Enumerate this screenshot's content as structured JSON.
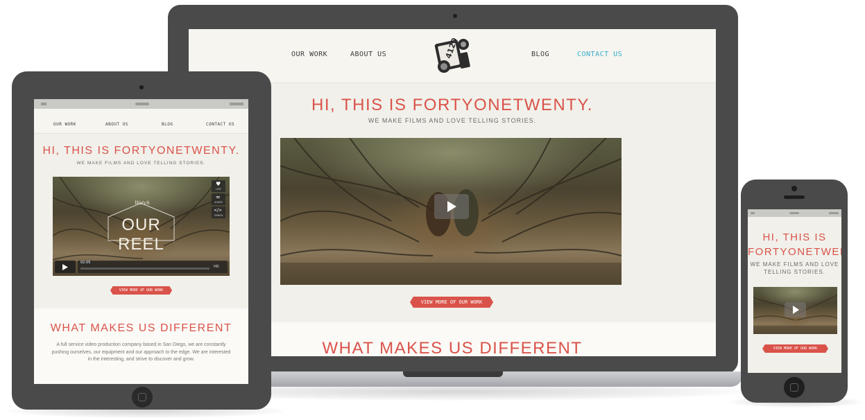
{
  "site": {
    "hero_title": "HI, THIS IS FORTYONETWENTY.",
    "hero_title_line1": "HI, THIS IS",
    "hero_title_line2": "FORTYONETWENTY.",
    "hero_subtitle": "WE MAKE FILMS AND LOVE TELLING STORIES.",
    "hero_subtitle_line1": "WE MAKE FILMS AND LOVE",
    "hero_subtitle_line2": "TELLING STORIES.",
    "cta_label": "VIEW MORE OF OUR WORK",
    "section_title": "WHAT MAKES US DIFFERENT",
    "section_body": "A full service video production company based in San Diego, we are constantly pushing ourselves, our equipment and our approach to the edge. We are interested in the interesting, and strive to discover and grow.",
    "logo_text": "4120"
  },
  "laptop": {
    "nav": [
      {
        "label": "OUR WORK",
        "active": false
      },
      {
        "label": "ABOUT US",
        "active": false
      },
      {
        "label": "BLOG",
        "active": false
      },
      {
        "label": "CONTACT US",
        "active": true
      }
    ]
  },
  "tablet": {
    "nav": [
      "OUR WORK",
      "ABOUT US",
      "BLOG",
      "CONTACT US"
    ],
    "video": {
      "watch_label": "Watch",
      "reel_label": "OUR REEL",
      "time": "02:05",
      "hd": "HD",
      "side_buttons": [
        "LIKE",
        "SHARE",
        "EMBED"
      ]
    }
  },
  "colors": {
    "accent": "#d9534a",
    "active_link": "#35aecb",
    "device": "#4a4a4a",
    "page_bg": "#f1f0ea"
  }
}
